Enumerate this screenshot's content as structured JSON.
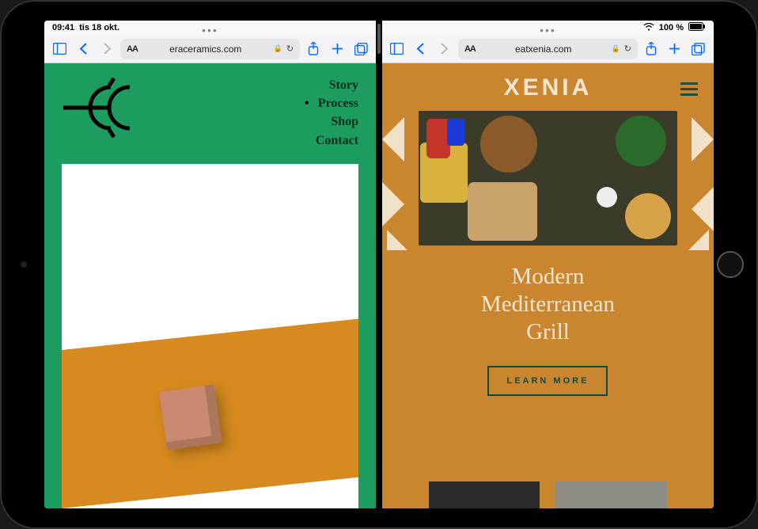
{
  "status": {
    "time": "09:41",
    "date": "tis 18 okt.",
    "battery_text": "100 %",
    "battery_icon": "battery-full-icon",
    "wifi_icon": "wifi-icon"
  },
  "panes": {
    "left": {
      "url": "eraceramics.com",
      "toolbar": {
        "sidebar": "sidebar-icon",
        "back": "back-icon",
        "forward": "forward-icon",
        "aa": "AA",
        "lock": "lock-icon",
        "reload": "reload-icon",
        "share": "share-icon",
        "newtab": "plus-icon",
        "tabs": "tabs-icon"
      },
      "site": {
        "logo": "EC",
        "nav": [
          {
            "label": "Story",
            "active": false
          },
          {
            "label": "Process",
            "active": true
          },
          {
            "label": "Shop",
            "active": false
          },
          {
            "label": "Contact",
            "active": false
          }
        ]
      }
    },
    "right": {
      "url": "eatxenia.com",
      "toolbar": {
        "sidebar": "sidebar-icon",
        "back": "back-icon",
        "forward": "forward-icon",
        "aa": "AA",
        "lock": "lock-icon",
        "reload": "reload-icon",
        "share": "share-icon",
        "newtab": "plus-icon",
        "tabs": "tabs-icon"
      },
      "site": {
        "logo": "XENIA",
        "burger": "hamburger-menu-icon",
        "headline_l1": "Modern",
        "headline_l2": "Mediterranean",
        "headline_l3": "Grill",
        "cta": "LEARN MORE"
      }
    }
  }
}
